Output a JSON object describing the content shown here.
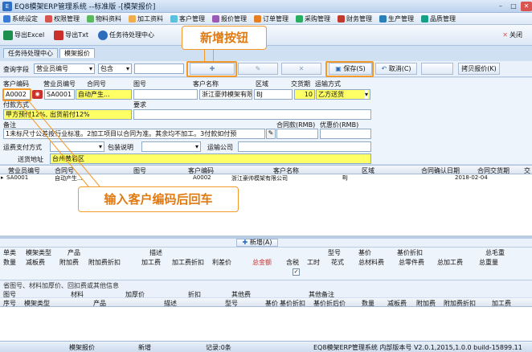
{
  "window": {
    "title": "EQ8模架ERP管理系统 --标准版 -[模架报价]"
  },
  "menu": [
    "系统设定",
    "权限管理",
    "物料资料",
    "加工资料",
    "客户管理",
    "报价管理",
    "订单管理",
    "采购管理",
    "财务管理",
    "生产管理",
    "品质管理"
  ],
  "toolbar": {
    "export_excel": "导出Excel",
    "export_txt": "导出Txt",
    "task_center": "任务待处理中心",
    "close": "关闭"
  },
  "tabs": [
    "任务待处理中心",
    "模架报价"
  ],
  "query": {
    "field_label": "查询字段",
    "field_value": "营业员编号",
    "op_value": "包含",
    "input_value": ""
  },
  "actions": {
    "save": "保存(S)",
    "cancel": "取消(C)",
    "copy": "拷贝报价(K)"
  },
  "form": {
    "labels": {
      "customer_code": "客户编码",
      "salesman_code": "营业员编号",
      "contract_no": "合同号",
      "drawing_no": "图号",
      "customer_name": "客户名称",
      "region": "区域",
      "delivery_days": "交货期",
      "shipping": "运输方式",
      "payment": "付款方式",
      "requirement": "要求",
      "remark": "备注",
      "contract_amount": "合同款(RMB)",
      "discount_amount": "优惠价(RMB)",
      "freight_payment": "运费支付方式",
      "packaging": "包装说明",
      "shipping_company": "运输公司",
      "delivery_address": "送货地址"
    },
    "values": {
      "customer_code": "A0002",
      "salesman_code": "SA0001",
      "contract_no": "自动产生...",
      "drawing_no": "",
      "customer_name": "浙江豪帅模架有限公司",
      "region": "BJ",
      "delivery_days": "10",
      "shipping": "乙方送货",
      "payment": "甲方预付12%, 出货前付12%",
      "requirement": "",
      "remark": "1未标尺寸公差按行业标准。2加工项目以合同为准。其余均不加工。3付款如付预",
      "contract_amount": "",
      "discount_amount": "",
      "freight_payment": "",
      "packaging": "",
      "shipping_company": "",
      "delivery_address": "台州黄岩区"
    }
  },
  "grid": {
    "headers": [
      "营业员编号",
      "合同号",
      "图号",
      "客户编码",
      "客户名称",
      "区域",
      "合同确认日期",
      "合同交货期",
      "交"
    ],
    "rows": [
      [
        "SA0001",
        "自动产生...",
        "",
        "A0002",
        "浙江豪帅模架有限公司",
        "BJ",
        "",
        "2018-02-04",
        ""
      ]
    ]
  },
  "callouts": {
    "new_button": "新增按钮",
    "enter_hint": "输入客户编码后回车"
  },
  "detail_toolbar": {
    "new": "新增(A)"
  },
  "detail_header": [
    "单类",
    "模架类型",
    "产品",
    "描述",
    "型号",
    "基价",
    "基价折扣",
    "总毛重"
  ],
  "detail_header2": [
    "数量",
    "减板费",
    "附加费",
    "附加费折扣",
    "加工费",
    "加工费折扣",
    "利差价",
    "总金额",
    "含税",
    "工时",
    "花式",
    "总材料费",
    "总零件费",
    "总加工费",
    "总重量"
  ],
  "sub_caption": "省图号、材料加厚价、回扣费或其他信息",
  "sub_labels": [
    "图号",
    "材料",
    "加厚价",
    "折扣",
    "其他费",
    "其他备注"
  ],
  "lower_header": [
    "序号",
    "模架类型",
    "产品",
    "描述",
    "型号",
    "基价",
    "基价折扣",
    "基价折后价",
    "数量",
    "减板费",
    "附加费",
    "附加费折扣",
    "加工费"
  ],
  "status": {
    "module": "模架报价",
    "mode": "新增",
    "records": "记录:0条",
    "version": "EQ8模架ERP管理系统 内部版本号 V2.0.1,2015,1.0.0 build-15899.11"
  },
  "colors": {
    "accent": "#f39a2b",
    "highlight": "#ffff66",
    "frame": "#cfe0f3"
  }
}
